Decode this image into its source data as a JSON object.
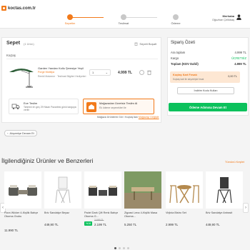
{
  "header": {
    "logo_text": "koctas.com.tr",
    "steps": [
      {
        "label": "Sepetim",
        "active": true
      },
      {
        "label": "Teslimat",
        "active": false
      },
      {
        "label": "Ödeme",
        "active": false
      }
    ],
    "user_greeting": "Merhaba",
    "user_name": "Oğuzhan Çelikbaş"
  },
  "cart": {
    "title": "Sepet",
    "count": "(1 Ürün)",
    "clear_label": "Sepeti Boşalt",
    "seller": "Koçtaş",
    "product": {
      "name": "Garden Yandan Kollu Şemsiye Yeşil",
      "brand": "Porge Mobilya",
      "variant": "Renkli Malzeme · Teslimat Bilgileri Hediyeleri",
      "qty": "1",
      "price": "4.999 TL"
    },
    "delivery": {
      "title": "Eve Teslim",
      "text": "Tahmini en geç 29 Nisan Pazartesi günü kargoya verilir"
    },
    "shipping": {
      "title": "Mağazadan Ücretsiz Teslim Al",
      "text": "Ek ödeme seçenekleri ile",
      "note_prefix": "Mağaza Ürünlerini Gör / Koçtaş'dan",
      "note_link": "Mağazayı Değiştir"
    },
    "continue_label": "Alışverişe Devam Et"
  },
  "summary": {
    "title": "Sipariş Özeti",
    "rows": [
      {
        "label": "Ara toplam",
        "value": "4.999 TL"
      },
      {
        "label": "Kargo",
        "value": "ÜCRETSİZ"
      },
      {
        "label": "Toplam (KDV Dahil)",
        "value": "4.999 TL"
      }
    ],
    "promo_title": "Koçtaş Kart Fırsatı",
    "promo_text": "Koçtaş kart ile alışverişte fırsat",
    "promo_value": "0,00 TL",
    "coupon_label": "İndirim Kodu Kullan",
    "confirm_label": "Ödeme Adımına Devam Et"
  },
  "recommendations": {
    "title": "İlgilendiğiniz Ürünler ve Benzerleri",
    "view_all": "Tümünü Keşfet",
    "prev_icon": "‹",
    "next_icon": "›",
    "items": [
      {
        "name": "Flora Wicker 4-Kişilik Bahçe Oturma Grubu",
        "price": "11.990 TL",
        "discount": null
      },
      {
        "name": "Briv Sandalye Beyaz",
        "price": "449,90 TL",
        "discount": null
      },
      {
        "name": "Padel Dark Çift Renk Bahçe Oturma G...",
        "price": "2.199 TL",
        "old_price": "2.599 TL",
        "discount": "%16"
      },
      {
        "name": "Zigzasi Lena 4-Kişilik Masa Oturma...",
        "price": "5.250 TL",
        "discount": null
      },
      {
        "name": "Virjinia Bistro Set",
        "price": "2.999 TL",
        "discount": null
      },
      {
        "name": "Briv Sandalye Antrasit",
        "price": "449,90 TL",
        "discount": null
      }
    ]
  },
  "colors": {
    "accent": "#f27a1a",
    "confirm": "#0bc15c"
  }
}
